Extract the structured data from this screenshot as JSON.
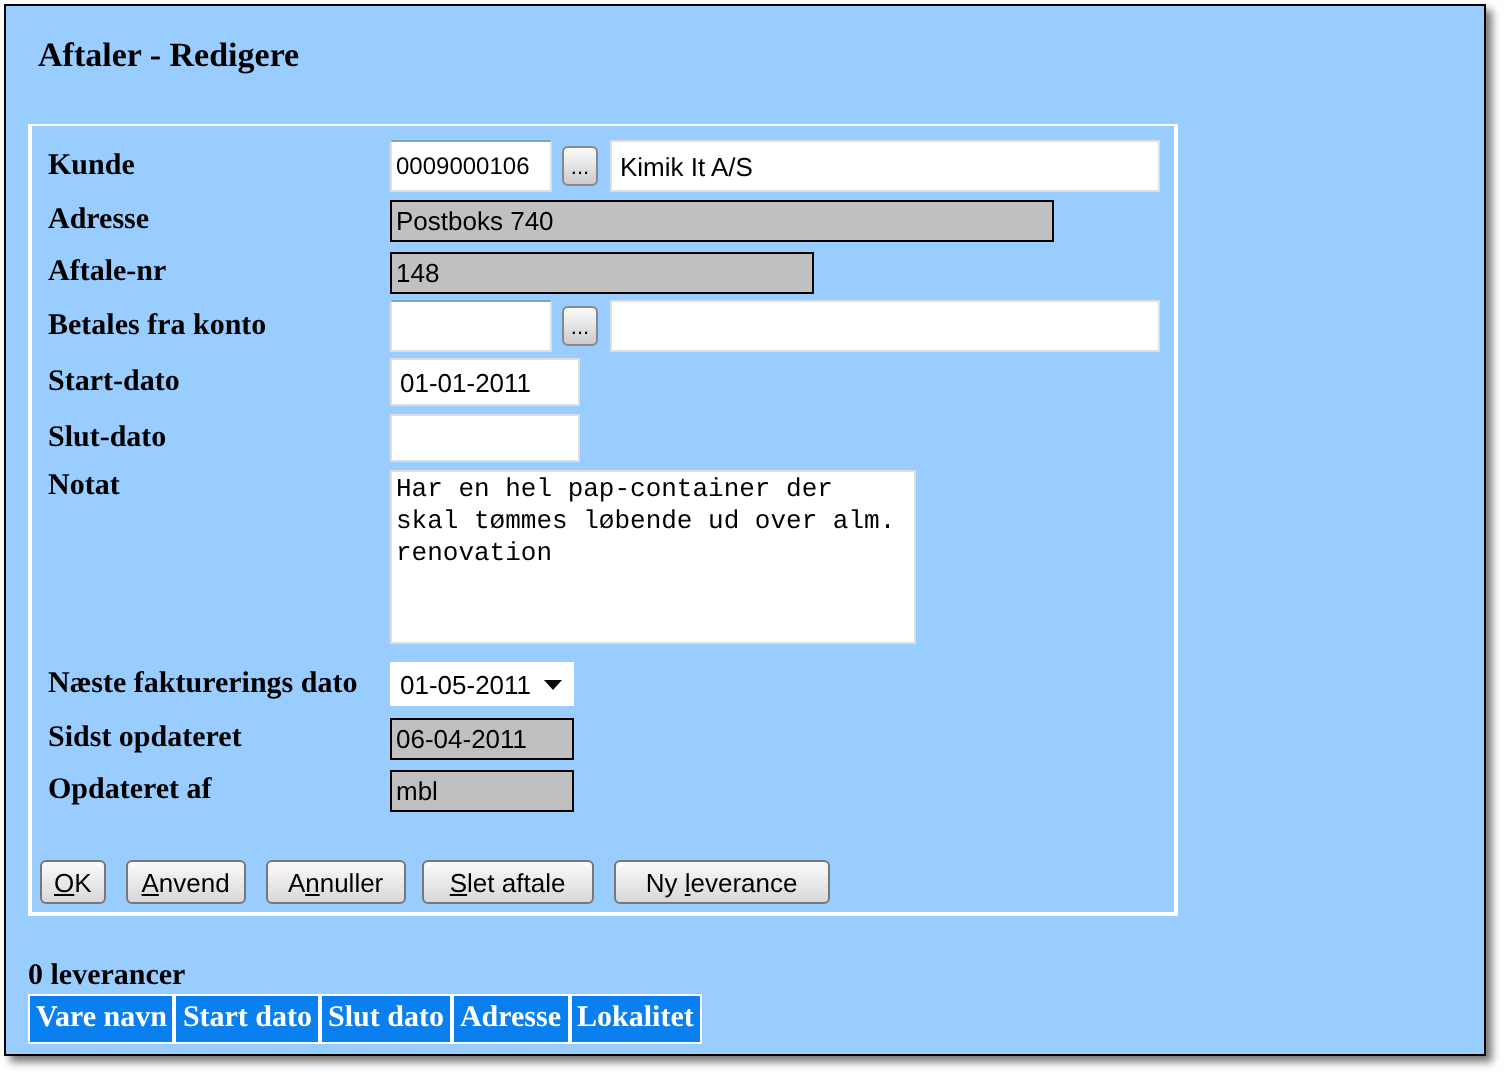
{
  "window": {
    "title": "Aftaler - Redigere"
  },
  "form": {
    "rows": [
      {
        "kind": "lookup",
        "label": "Kunde",
        "code": "0009000106",
        "browse": "...",
        "name": "Kimik It A/S"
      },
      {
        "kind": "readonly",
        "label": "Adresse",
        "value": "Postboks 740"
      },
      {
        "kind": "readonly",
        "label": "Aftale-nr",
        "value": "148"
      },
      {
        "kind": "lookup",
        "label": "Betales fra konto",
        "browse": "..."
      },
      {
        "kind": "text",
        "label": "Start-dato",
        "value": "01-01-2011"
      },
      {
        "kind": "text",
        "label": "Slut-dato"
      },
      {
        "kind": "textarea",
        "label": "Notat",
        "value": "Har en hel pap-container der skal tømmes løbende ud over alm. renovation"
      },
      {
        "kind": "select",
        "label": "Næste fakturerings dato",
        "value": "01-05-2011"
      },
      {
        "kind": "readonly",
        "label": "Sidst opdateret",
        "value": "06-04-2011"
      },
      {
        "kind": "readonly",
        "label": "Opdateret af",
        "value": "mbl"
      }
    ],
    "buttons": [
      {
        "key": "O",
        "post": "K"
      },
      {
        "key": "A",
        "post": "nvend"
      },
      {
        "pre": "A",
        "key": "n",
        "post": "nuller"
      },
      {
        "key": "S",
        "post": "let aftale"
      },
      {
        "pre": "Ny ",
        "key": "l",
        "post": "everance"
      }
    ]
  },
  "deliveries": {
    "count": "0 leverancer",
    "columns": [
      "Vare navn",
      "Start dato",
      "Slut dato",
      "Adresse",
      "Lokalitet"
    ]
  }
}
